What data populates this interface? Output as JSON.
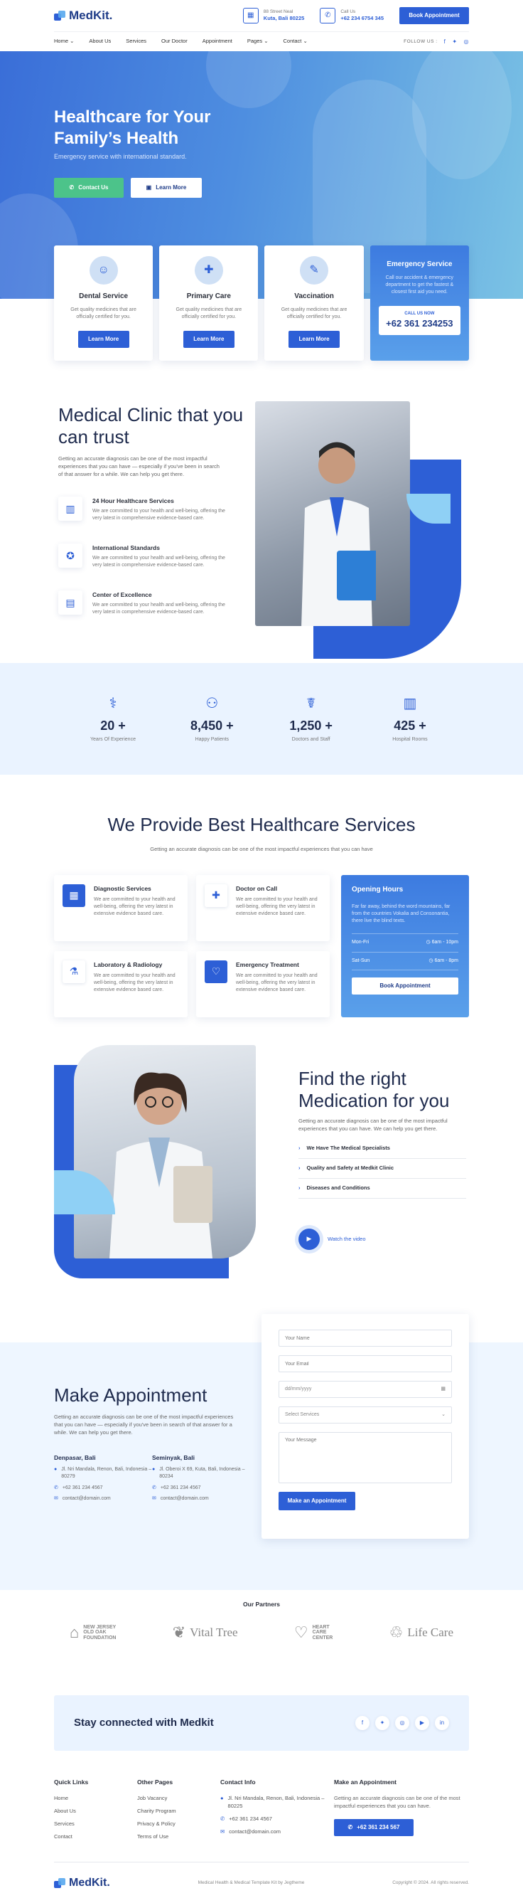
{
  "brand": {
    "name": "MedKit.",
    "accent": "#2d5fd6",
    "green": "#4cc38a"
  },
  "header": {
    "address_line1": "88 Street Neal",
    "address_line2": "Kuta, Bali 80225",
    "call_label": "Call Us",
    "phone": "+62 234 6754 345",
    "book_button": "Book Appointment"
  },
  "nav": {
    "items": [
      "Home",
      "About Us",
      "Services",
      "Our Doctor",
      "Appointment",
      "Pages",
      "Contact"
    ],
    "follow_label": "FOLLOW US :",
    "social_icons": [
      "facebook-icon",
      "twitter-icon",
      "instagram-icon"
    ]
  },
  "hero": {
    "title": "Healthcare for Your Family’s Health",
    "subtitle": "Emergency service with international standard.",
    "contact_button": "Contact Us",
    "learn_button": "Learn More"
  },
  "service_cards": [
    {
      "title": "Dental Service",
      "text": "Get quality medicines that are officially certified for you.",
      "button": "Learn More"
    },
    {
      "title": "Primary Care",
      "text": "Get quality medicines that are officially certified for you.",
      "button": "Learn More"
    },
    {
      "title": "Vaccination",
      "text": "Get quality medicines that are officially certified for you.",
      "button": "Learn More"
    }
  ],
  "emergency": {
    "title": "Emergency Service",
    "text": "Call our accident & emergency department to get the fastest & closest first aid you need.",
    "call_label": "CALL US NOW",
    "phone": "+62 361 234253"
  },
  "about": {
    "title": "Medical Clinic that you can trust",
    "lead": "Getting an accurate diagnosis can be one of the most impactful experiences that you can have — especially if you've been in search of that answer for a while. We can help you get there.",
    "features": [
      {
        "title": "24 Hour Healthcare Services",
        "text": "We are committed to your health and well-being, offering the very latest in comprehensive evidence-based care."
      },
      {
        "title": "International Standards",
        "text": "We are committed to your health and well-being, offering the very latest in comprehensive evidence-based care."
      },
      {
        "title": "Center of Excellence",
        "text": "We are committed to your health and well-being, offering the very latest in comprehensive evidence-based care."
      }
    ]
  },
  "stats": [
    {
      "value": "20 +",
      "label": "Years Of Experience"
    },
    {
      "value": "8,450 +",
      "label": "Happy Patients"
    },
    {
      "value": "1,250 +",
      "label": "Doctors and Staff"
    },
    {
      "value": "425 +",
      "label": "Hospital Rooms"
    }
  ],
  "services": {
    "title": "We Provide Best Healthcare Services",
    "lead": "Getting an accurate diagnosis can be one of the most impactful experiences that you can have",
    "items": [
      {
        "title": "Diagnostic Services",
        "text": "We are committed to your health and well-being, offering the very latest in extensive evidence based care."
      },
      {
        "title": "Doctor on Call",
        "text": "We are committed to your health and well-being, offering the very latest in extensive evidence based care."
      },
      {
        "title": "Laboratory & Radiology",
        "text": "We are committed to your health and well-being, offering the very latest in extensive evidence based care."
      },
      {
        "title": "Emergency Treatment",
        "text": "We are committed to your health and well-being, offering the very latest in extensive evidence based care."
      }
    ],
    "hours": {
      "title": "Opening Hours",
      "text": "Far far away, behind the word mountains, far from the countries Vokalia and Consonantia, there live the blind texts.",
      "rows": [
        {
          "day": "Mon-Fri",
          "time": "6am - 10pm"
        },
        {
          "day": "Sat-Sun",
          "time": "6am - 8pm"
        }
      ],
      "button": "Book Appointment"
    }
  },
  "medication": {
    "title": "Find the right Medication for you",
    "lead": "Getting an accurate diagnosis can be one of the most impactful experiences that you can have. We can help you get there.",
    "items": [
      "We Have The Medical Specialists",
      "Quality and Safety at Medkit Clinic",
      "Diseases and Conditions"
    ],
    "video_label": "Watch the video"
  },
  "appointment": {
    "title": "Make Appointment",
    "lead": "Getting an accurate diagnosis can be one of the most impactful experiences that you can have — especially if you've been in search of that answer for a while. We can help you get there.",
    "locations": [
      {
        "name": "Denpasar, Bali",
        "address": "Jl. Nri Mandala, Renon, Bali, Indonesia – 80279",
        "phone": "+62 361 234 4567",
        "email": "contact@domain.com"
      },
      {
        "name": "Seminyak, Bali",
        "address": "Jl. Oberoi X 69, Kuta, Bali, Indonesia – 80234",
        "phone": "+62 361 234 4567",
        "email": "contact@domain.com"
      }
    ],
    "form": {
      "name_placeholder": "Your Name",
      "email_placeholder": "Your Email",
      "date_placeholder": "dd/mm/yyyy",
      "select_value": "Select Services",
      "message_placeholder": "Your Message",
      "submit": "Make an Appointment"
    }
  },
  "partners": {
    "title": "Our Partners",
    "logos": [
      {
        "lines": [
          "NEW JERSEY",
          "OLD OAK",
          "FOUNDATION"
        ]
      },
      {
        "lines": [
          "Vital Tree"
        ]
      },
      {
        "lines": [
          "HEART",
          "CARE",
          "CENTER"
        ]
      },
      {
        "lines": [
          "Life Care"
        ]
      }
    ]
  },
  "newsletter": {
    "title": "Stay connected with Medkit",
    "social_icons": [
      "facebook-icon",
      "twitter-icon",
      "instagram-icon",
      "youtube-icon",
      "linkedin-icon"
    ]
  },
  "footer": {
    "quick_links_title": "Quick Links",
    "quick_links": [
      "Home",
      "About Us",
      "Services",
      "Contact"
    ],
    "other_pages_title": "Other Pages",
    "other_pages": [
      "Job Vacancy",
      "Charity Program",
      "Privacy & Policy",
      "Terms of Use"
    ],
    "contact_title": "Contact Info",
    "contact_address": "Jl. Nri Mandala, Renon, Bali, Indonesia – 80225",
    "contact_phone": "+62 361 234 4567",
    "contact_email": "contact@domain.com",
    "appt_title": "Make an Appointment",
    "appt_text": "Getting an accurate diagnosis can be one of the most impactful experiences that you can have.",
    "appt_phone": "+62 361 234 567",
    "credit": "Medical Health & Medical Template Kit by Jegtheme",
    "copyright": "Copyright © 2024. All rights reserved."
  }
}
